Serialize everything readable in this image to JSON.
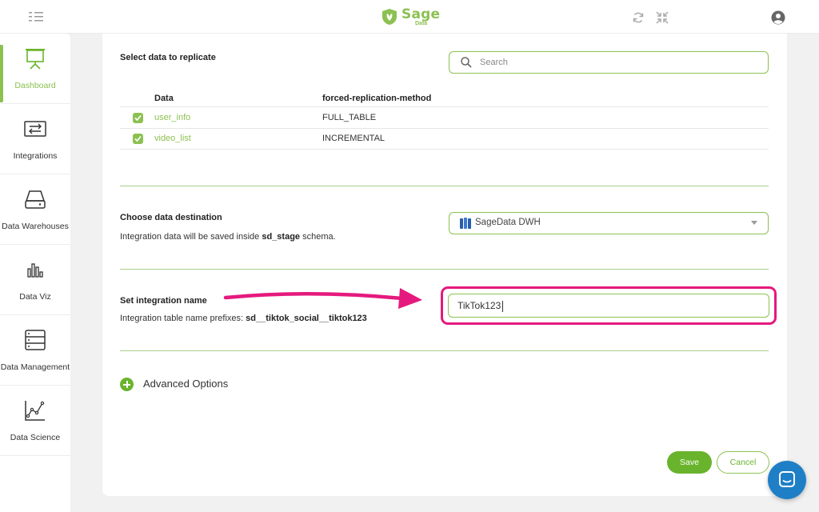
{
  "header": {
    "logo_text": "Sage",
    "logo_sub": "Data"
  },
  "sidebar": {
    "items": [
      {
        "label": "Dashboard",
        "icon": "presentation-board-icon"
      },
      {
        "label": "Integrations",
        "icon": "arrows-exchange-icon"
      },
      {
        "label": "Data Warehouses",
        "icon": "hard-drive-icon"
      },
      {
        "label": "Data Viz",
        "icon": "bar-chart-icon"
      },
      {
        "label": "Data Management",
        "icon": "server-rack-icon"
      },
      {
        "label": "Data Science",
        "icon": "line-chart-icon"
      }
    ],
    "active": "Dashboard"
  },
  "replicate": {
    "title": "Select data to replicate",
    "search_placeholder": "Search",
    "columns": [
      "Data",
      "forced-replication-method"
    ],
    "rows": [
      {
        "name": "user_info",
        "method": "FULL_TABLE",
        "checked": true
      },
      {
        "name": "video_list",
        "method": "INCREMENTAL",
        "checked": true
      }
    ]
  },
  "destination": {
    "title": "Choose data destination",
    "desc_prefix": "Integration data will be saved inside ",
    "schema": "sd_stage",
    "desc_suffix": " schema.",
    "selected": "SageData DWH"
  },
  "integration_name": {
    "title": "Set integration name",
    "desc_prefix": "Integration table name prefixes: ",
    "prefix_value": "sd__tiktok_social__tiktok123",
    "value": "TikTok123"
  },
  "advanced": {
    "label": "Advanced Options"
  },
  "actions": {
    "save": "Save",
    "cancel": "Cancel"
  },
  "colors": {
    "accent_green": "#8cc152",
    "button_green": "#6ab42d",
    "highlight_pink": "#e5197d",
    "chat_blue": "#1f7fc6"
  }
}
